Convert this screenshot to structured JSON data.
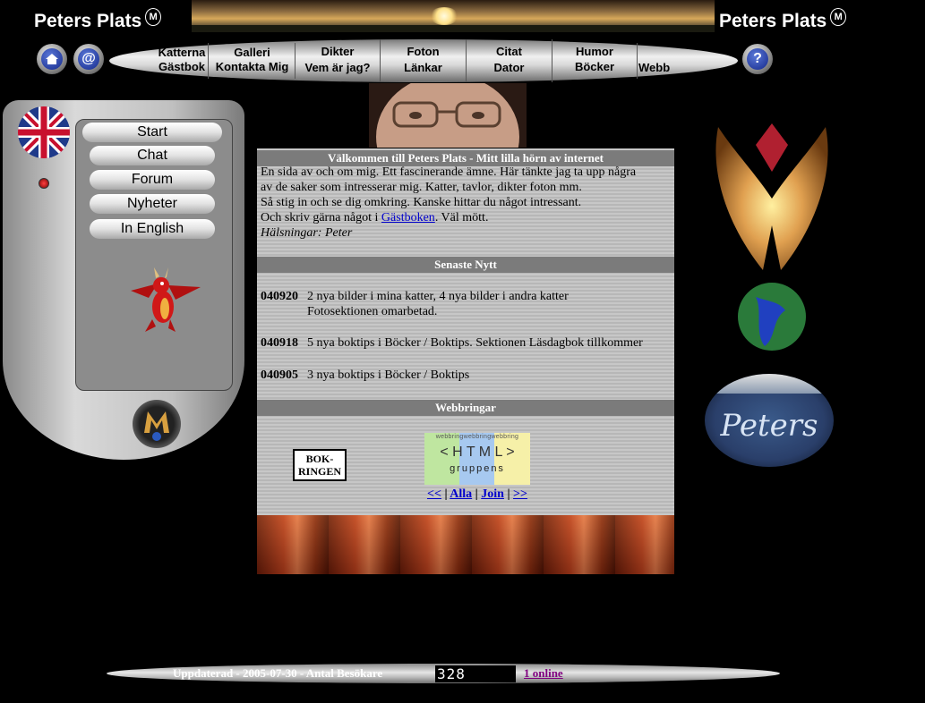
{
  "header": {
    "logo_left": "Peters Plats",
    "logo_right": "Peters Plats"
  },
  "nav": {
    "row1": [
      "Katterna",
      "Galleri",
      "Dikter",
      "Foton",
      "Citat",
      "Humor"
    ],
    "row2": [
      "Gästbok",
      "Kontakta Mig",
      "Vem är jag?",
      "Länkar",
      "Dator",
      "Böcker",
      "Webb"
    ],
    "icons": [
      "home-icon",
      "email-icon",
      "help-icon"
    ],
    "help_label": "?",
    "email_label": "@"
  },
  "sidebar": {
    "items": [
      "Start",
      "Chat",
      "Forum",
      "Nyheter",
      "In English"
    ],
    "badge_label": "M"
  },
  "welcome": {
    "title": "Välkommen till Peters Plats - Mitt lilla hörn av internet",
    "line1": "En sida av och om mig. Ett fascinerande ämne. Här tänkte jag ta upp några",
    "line2": "av de saker som intresserar mig. Katter, tavlor, dikter foton mm.",
    "line3": "Så stig in och se dig omkring. Kanske hittar du något intressant.",
    "line4_before": "Och skriv gärna något i ",
    "line4_link": "Gästboken",
    "line4_after": ". Väl mött.",
    "sign": "Hälsningar: Peter"
  },
  "news": {
    "title": "Senaste Nytt",
    "items": [
      {
        "date": "040920",
        "text": "2 nya bilder i mina katter, 4 nya bilder i andra katter",
        "text2": "Fotosektionen omarbetad."
      },
      {
        "date": "040918",
        "text": "5 nya boktips i Böcker / Boktips. Sektionen Läsdagbok tillkommer",
        "text2": ""
      },
      {
        "date": "040905",
        "text": "3 nya boktips i Böcker / Boktips",
        "text2": ""
      }
    ]
  },
  "webrings": {
    "title": "Webbringar",
    "bokring": "BOK-\nRINGEN",
    "html_top": "webbringwebbringwebbring",
    "html_mid": "< H T M L >",
    "html_sub": "gruppens",
    "links": [
      "<<",
      "Alla",
      "Join",
      ">>"
    ]
  },
  "right": {
    "logo_text": "Peters"
  },
  "footer": {
    "updated": "Uppdaterad - 2005-07-30 - Antal Besökare",
    "counter": "328",
    "online": "1 online"
  },
  "colors": {
    "link": "#0000cc",
    "visited": "#800080",
    "header_bar": "#7b7b7b"
  }
}
